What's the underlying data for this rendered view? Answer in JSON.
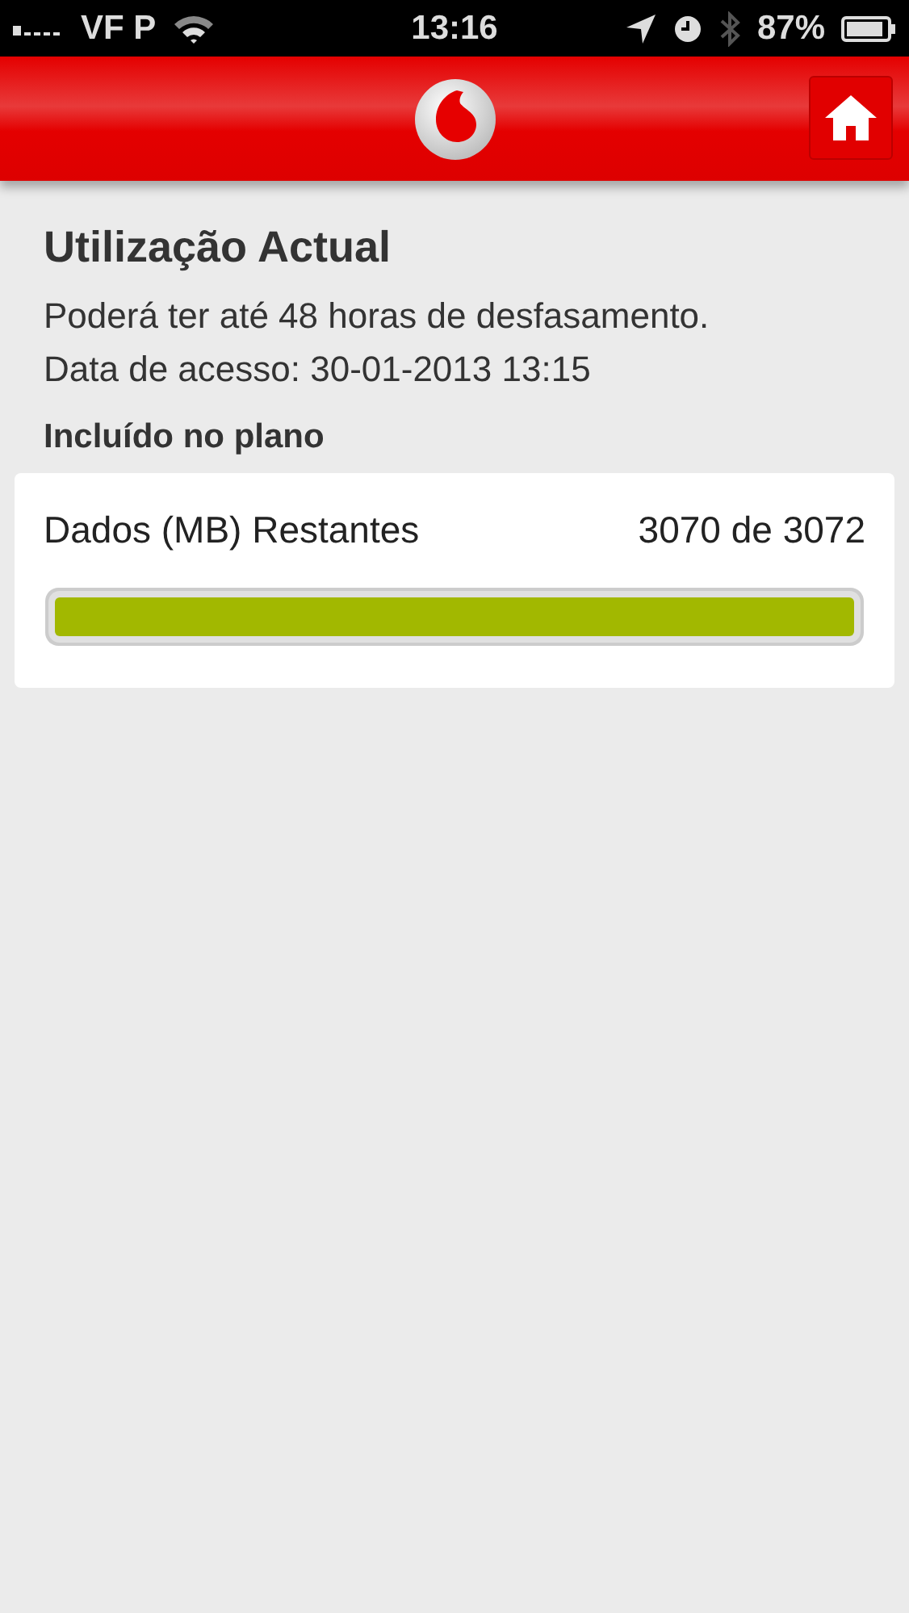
{
  "status_bar": {
    "carrier": "VF P",
    "time": "13:16",
    "battery": "87%"
  },
  "title": "Utilização Actual",
  "notes": [
    "Poderá ter até 48 horas de desfasamento.",
    "Data de acesso: 30-01-2013 13:15"
  ],
  "section": "Incluído no plano",
  "items": [
    {
      "name": "Dados (MB) Restantes",
      "reading": "3070 de 3072",
      "level": 0.999
    }
  ]
}
